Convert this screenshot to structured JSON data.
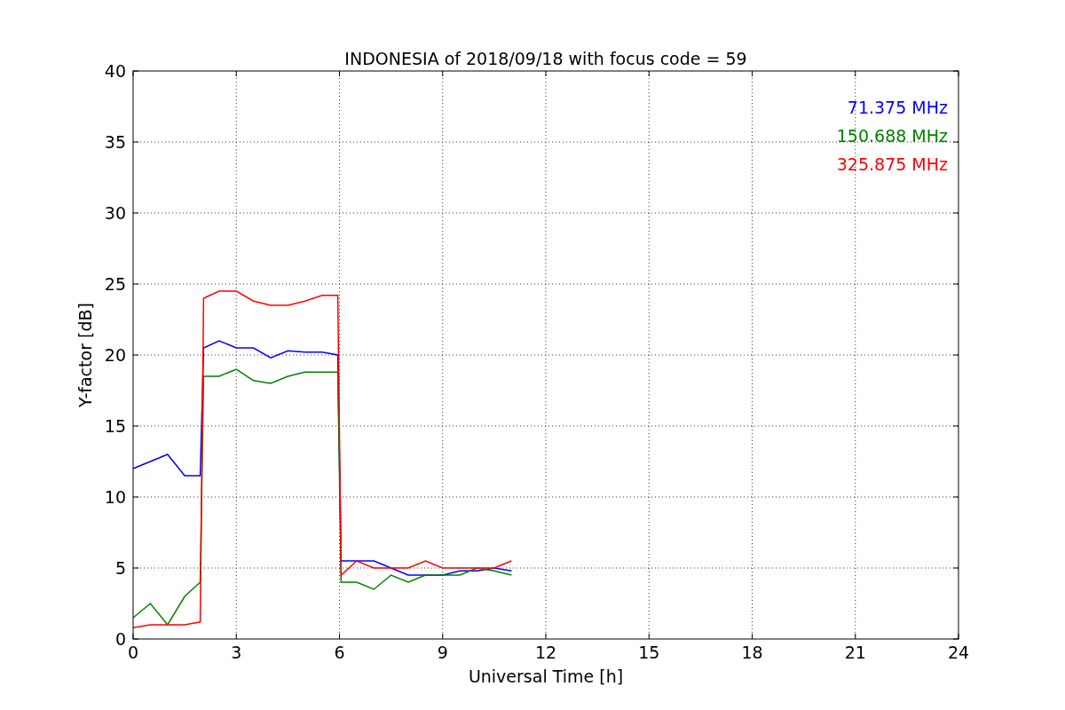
{
  "figure": {
    "chart_data": {
      "type": "line",
      "title": "INDONESIA of 2018/09/18 with focus code = 59",
      "xlabel": "Universal Time [h]",
      "ylabel": "Y-factor [dB]",
      "x": [
        0,
        0.5,
        1,
        1.5,
        1.95,
        2.05,
        2.5,
        3,
        3.5,
        4,
        4.5,
        5,
        5.5,
        5.95,
        6.05,
        6.5,
        7,
        7.5,
        8,
        8.5,
        9,
        9.5,
        10,
        10.5,
        11
      ],
      "series": [
        {
          "name": "71.375 MHz",
          "color": "#0000ff",
          "values": [
            12,
            12.5,
            13,
            11.5,
            11.5,
            20.5,
            21,
            20.5,
            20.5,
            19.8,
            20.3,
            20.2,
            20.2,
            20,
            5.5,
            5.5,
            5.5,
            5,
            4.5,
            4.5,
            4.5,
            4.8,
            4.8,
            5,
            4.8
          ]
        },
        {
          "name": "150.688 MHz",
          "color": "#008000",
          "values": [
            1.5,
            2.5,
            1,
            3,
            4,
            18.5,
            18.5,
            19,
            18.2,
            18,
            18.5,
            18.8,
            18.8,
            18.8,
            4,
            4,
            3.5,
            4.5,
            4,
            4.5,
            4.5,
            4.5,
            5,
            4.8,
            4.5
          ]
        },
        {
          "name": "325.875 MHz",
          "color": "#ff0000",
          "values": [
            0.8,
            1,
            1,
            1,
            1.2,
            24,
            24.5,
            24.5,
            23.8,
            23.5,
            23.5,
            23.8,
            24.2,
            24.2,
            4.5,
            5.5,
            5,
            5,
            5,
            5.5,
            5,
            5,
            5,
            5,
            5.5
          ]
        }
      ],
      "grid": true,
      "xlim": [
        0,
        24
      ],
      "ylim": [
        0,
        40
      ],
      "xticks": [
        0,
        3,
        6,
        9,
        12,
        15,
        18,
        21,
        24
      ],
      "yticks": [
        0,
        5,
        10,
        15,
        20,
        25,
        30,
        35,
        40
      ]
    }
  }
}
